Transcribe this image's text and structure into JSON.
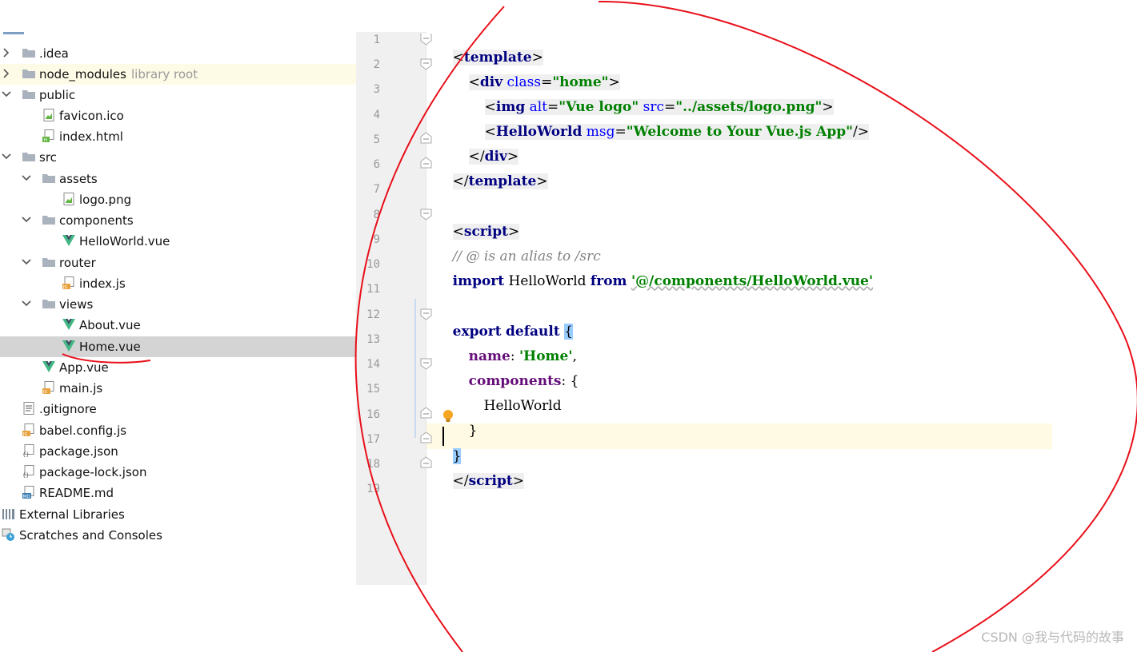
{
  "tree": {
    "items": [
      {
        "label": ".idea",
        "icon": "folder-icon",
        "expanded": false
      },
      {
        "label": "node_modules",
        "suffix": "library root",
        "icon": "folder-icon",
        "expanded": false
      },
      {
        "label": "public",
        "icon": "folder-icon",
        "expanded": true
      },
      {
        "label": "favicon.ico",
        "icon": "image-file-icon"
      },
      {
        "label": "index.html",
        "icon": "html-file-icon"
      },
      {
        "label": "src",
        "icon": "folder-icon",
        "expanded": true
      },
      {
        "label": "assets",
        "icon": "folder-icon",
        "expanded": true
      },
      {
        "label": "logo.png",
        "icon": "image-file-icon"
      },
      {
        "label": "components",
        "icon": "folder-icon",
        "expanded": true
      },
      {
        "label": "HelloWorld.vue",
        "icon": "vue-file-icon"
      },
      {
        "label": "router",
        "icon": "folder-icon",
        "expanded": true
      },
      {
        "label": "index.js",
        "icon": "js-file-icon"
      },
      {
        "label": "views",
        "icon": "folder-icon",
        "expanded": true
      },
      {
        "label": "About.vue",
        "icon": "vue-file-icon"
      },
      {
        "label": "Home.vue",
        "icon": "vue-file-icon",
        "selected": true
      },
      {
        "label": "App.vue",
        "icon": "vue-file-icon"
      },
      {
        "label": "main.js",
        "icon": "js-file-icon"
      },
      {
        "label": ".gitignore",
        "icon": "text-file-icon"
      },
      {
        "label": "babel.config.js",
        "icon": "js-file-icon"
      },
      {
        "label": "package.json",
        "icon": "json-file-icon"
      },
      {
        "label": "package-lock.json",
        "icon": "json-file-icon"
      },
      {
        "label": "README.md",
        "icon": "markdown-file-icon"
      },
      {
        "label": "External Libraries",
        "icon": "libraries-icon"
      },
      {
        "label": "Scratches and Consoles",
        "icon": "scratches-icon"
      }
    ]
  },
  "editor": {
    "line_numbers": [
      "1",
      "2",
      "3",
      "4",
      "5",
      "6",
      "7",
      "8",
      "9",
      "10",
      "11",
      "12",
      "13",
      "14",
      "15",
      "16",
      "17",
      "18",
      "19"
    ],
    "code": {
      "l1": {
        "open": "<",
        "tag": "template",
        "close": ">"
      },
      "l2": {
        "open": "<",
        "tag": "div",
        "attr": "class",
        "eq": "=",
        "val": "\"home\"",
        "close": ">"
      },
      "l3": {
        "open": "<",
        "tag": "img",
        "attr1": "alt",
        "eq1": "=",
        "val1": "\"Vue logo\"",
        "attr2": "src",
        "eq2": "=",
        "val2": "\"../assets/logo.png\"",
        "close": ">"
      },
      "l4": {
        "open": "<",
        "tag": "HelloWorld",
        "attr": "msg",
        "eq": "=",
        "val": "\"Welcome to Your Vue.js App\"",
        "close": "/>"
      },
      "l5": {
        "open": "</",
        "tag": "div",
        "close": ">"
      },
      "l6": {
        "open": "</",
        "tag": "template",
        "close": ">"
      },
      "l8": {
        "open": "<",
        "tag": "script",
        "close": ">"
      },
      "l9": {
        "comment": "// @ is an alias to /src"
      },
      "l10": {
        "kw1": "import",
        "name": " HelloWorld ",
        "kw2": "from",
        "str": "'@/components/HelloWorld.vue'"
      },
      "l12": {
        "kw1": "export",
        "kw2": "default",
        "brace": "{"
      },
      "l13": {
        "prop": "name",
        "colon": ": ",
        "str": "'Home'",
        "comma": ","
      },
      "l14": {
        "prop": "components",
        "colon": ": ",
        "brace": "{"
      },
      "l15": {
        "text": "HelloWorld"
      },
      "l16": {
        "text": "}"
      },
      "l17": {
        "text": "}"
      },
      "l18": {
        "open": "</",
        "tag": "script",
        "close": ">"
      }
    }
  },
  "watermark": "CSDN @我与代码的故事",
  "colors": {
    "tag": "#000080",
    "attr": "#0000ff",
    "string": "#008000",
    "comment": "#808080",
    "property": "#660e7a",
    "annotation": "#e8101a",
    "vue_green": "#41b883"
  }
}
